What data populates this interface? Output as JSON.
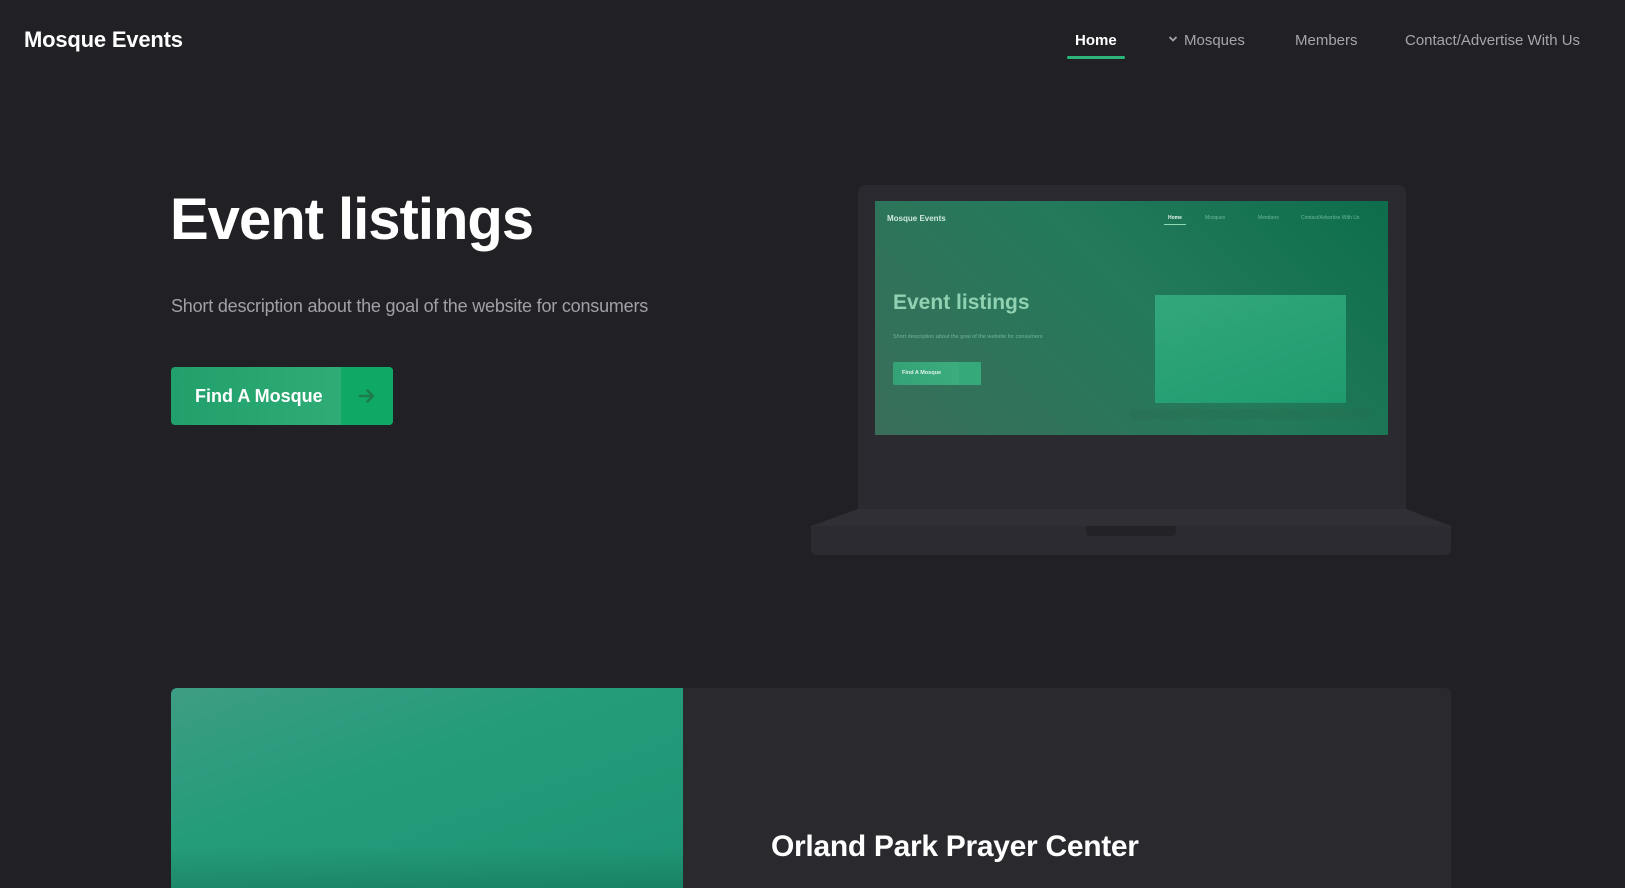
{
  "nav": {
    "brand": "Mosque Events",
    "items": [
      {
        "label": "Home",
        "active": true
      },
      {
        "label": "Mosques",
        "has_dropdown": true
      },
      {
        "label": "Members"
      },
      {
        "label": "Contact/Advertise With Us"
      }
    ]
  },
  "hero": {
    "title": "Event listings",
    "description": "Short description about the goal of the website for consumers",
    "cta_label": "Find A Mosque"
  },
  "mockup": {
    "brand": "Mosque Events",
    "nav": [
      "Home",
      "Mosques",
      "Members",
      "Contact/Advertise With Us"
    ],
    "title": "Event listings",
    "description": "Short description about the goal of the website for consumers",
    "cta_label": "Find A Mosque"
  },
  "listing": {
    "title": "Orland Park Prayer Center"
  },
  "colors": {
    "background": "#212125",
    "accent": "#2bb57a",
    "cta_arrow_bg": "#0fa865",
    "card_bg": "#29292e"
  },
  "icons": {
    "dropdown": "chevron-down-icon",
    "cta": "arrow-right-icon"
  }
}
